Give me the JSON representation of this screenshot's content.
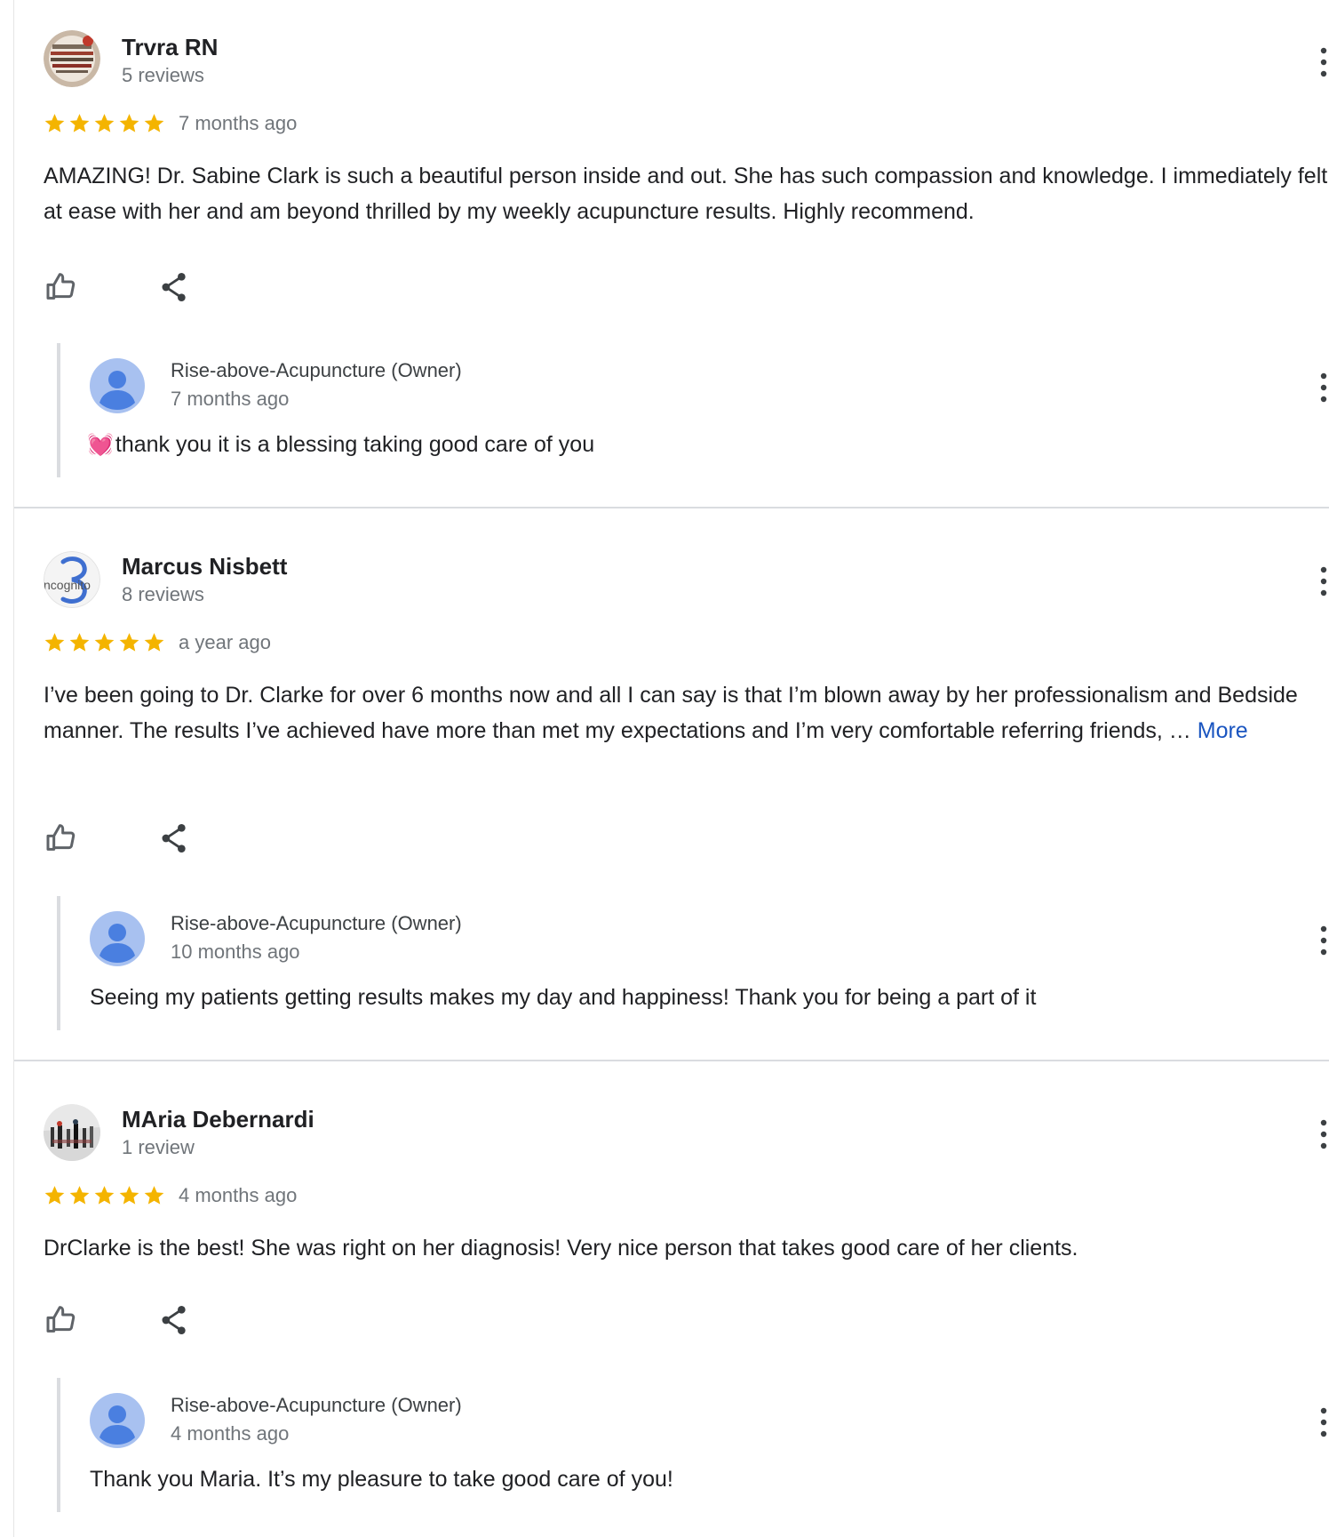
{
  "colors": {
    "star": "#f4b400",
    "link": "#1a55c0",
    "secondary_text": "#70757a",
    "divider": "#dadce0",
    "owner_avatar": "#a8c1f0"
  },
  "icons": {
    "like": "thumb-up-outline",
    "share": "share",
    "more": "three-dot-vertical",
    "owner_avatar": "default-person-avatar"
  },
  "reviews": [
    {
      "name": "Trvra RN",
      "count": "5 reviews",
      "rating": 5,
      "date": "7 months ago",
      "text": "AMAZING! Dr. Sabine Clark is such a beautiful person inside and out. She has such compassion and knowledge. I immediately felt at ease with her and am beyond thrilled by my weekly acupuncture results. Highly recommend.",
      "more_label": "",
      "reply": {
        "owner": "Rise-above-Acupuncture (Owner)",
        "date": "7 months ago",
        "emoji": "💓",
        "text": "thank you it is a blessing taking good care of you"
      }
    },
    {
      "name": "Marcus Nisbett",
      "count": "8 reviews",
      "rating": 5,
      "date": "a year ago",
      "text": "I’ve been going to Dr. Clarke for over 6 months now and all I can say is that I’m blown away by her professionalism and Bedside manner. The results I’ve achieved have more than met my expectations and I’m very comfortable referring friends, …",
      "more_label": "More",
      "avatar_text": "ncognito",
      "reply": {
        "owner": "Rise-above-Acupuncture (Owner)",
        "date": "10 months ago",
        "text": "Seeing my patients getting results makes my day and happiness! Thank you for being a part of it"
      }
    },
    {
      "name": "MAria Debernardi",
      "count": "1 review",
      "rating": 5,
      "date": "4 months ago",
      "text": "DrClarke is the best! She was right on her diagnosis! Very nice person that takes good care of her clients.",
      "more_label": "",
      "reply": {
        "owner": "Rise-above-Acupuncture (Owner)",
        "date": "4 months ago",
        "text": "Thank you Maria. It’s my pleasure to take good care of you!"
      }
    }
  ]
}
